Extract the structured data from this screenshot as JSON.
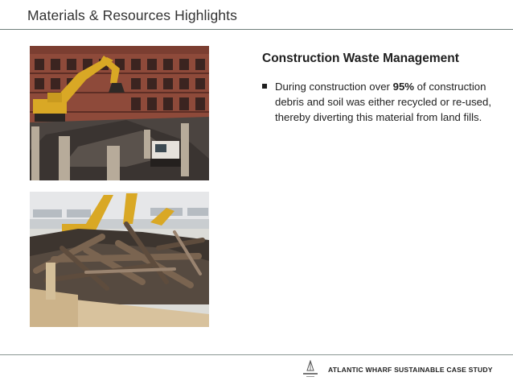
{
  "header": {
    "title": "Materials & Resources Highlights"
  },
  "photos": [
    {
      "subject": "excavator on demolition site with brick building"
    },
    {
      "subject": "pile of extracted wooden piles with excavators"
    }
  ],
  "content": {
    "heading": "Construction Waste Management",
    "bullet": {
      "before": "During construction over ",
      "emphasis": "95%",
      "after": " of construction debris and soil was either recycled or re-used, thereby diverting this material from land fills."
    }
  },
  "footer": {
    "logo_text": "ATLANTIC",
    "label": "ATLANTIC WHARF SUSTAINABLE CASE STUDY"
  }
}
